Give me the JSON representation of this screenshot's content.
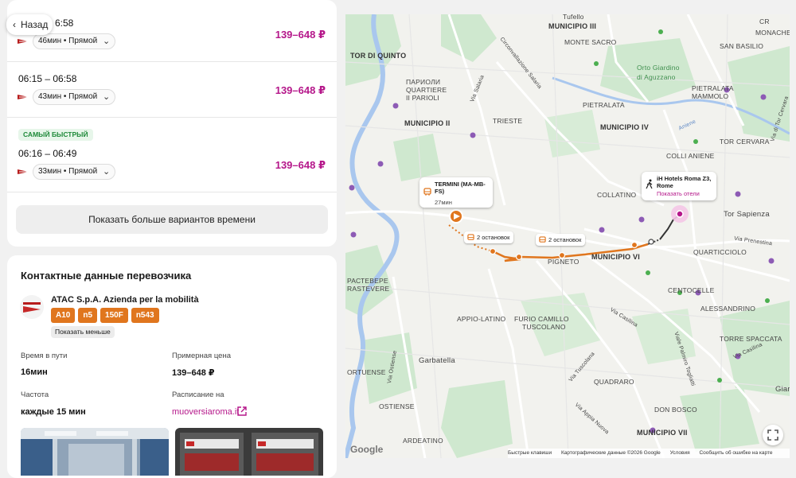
{
  "header": {
    "back_label": "Назад"
  },
  "trips": [
    {
      "time": "6:58",
      "duration": "46мин • Прямой",
      "price": "139–648 ₽"
    },
    {
      "time": "06:15 – 06:58",
      "duration": "43мин • Прямой",
      "price": "139–648 ₽"
    },
    {
      "badge": "САМЫЙ БЫСТРЫЙ",
      "time": "06:16 – 06:49",
      "duration": "33мин • Прямой",
      "price": "139–648 ₽"
    }
  ],
  "more_times_label": "Показать больше вариантов времени",
  "carrier": {
    "title": "Контактные данные перевозчика",
    "name": "ATAC S.p.A. Azienda per la mobilità",
    "routes": [
      "A10",
      "n5",
      "150F",
      "n543"
    ],
    "show_less_label": "Показать меньше",
    "travel_time_label": "Время в пути",
    "travel_time_value": "16мин",
    "price_label": "Примерная цена",
    "price_value": "139–648 ₽",
    "frequency_label": "Частота",
    "frequency_value": "каждые 15 мин",
    "schedule_label": "Расписание на",
    "schedule_link": "muoversiaroma.it"
  },
  "map": {
    "labels": {
      "tor_di_quinto": "TOR DI QUINTO",
      "tufello": "Tufello",
      "mun3": "MUNICIPIO III",
      "monte_sacro": "MONTE SACRO",
      "san_basilio": "SAN BASILIO",
      "cr": "CR",
      "monachese": "MONACHESE",
      "parioli": "ПАРИОЛИ",
      "quartiere": "QUARTIERE",
      "ii_parioli": "II PARIOLI",
      "orto_giardino": "Orto Giardino",
      "di_aguzzano": "di Aguzzano",
      "ponte_mammolo": "PONTE\nMAMMOLO",
      "pietralata": "PIETRALATA",
      "trieste": "TRIESTE",
      "mun2": "MUNICIPIO II",
      "mun4": "MUNICIPIO IV",
      "tor_cervara": "TOR CERVARA",
      "colli_aniene": "COLLI ANIENE",
      "collatino": "COLLATINO",
      "tor_sapienza": "Tor Sapienza",
      "quarticciolo": "QUARTICCIOLO",
      "mun6": "MUNICIPIO VI",
      "pigneto": "PIGNETO",
      "centocelle": "CENTOCELLE",
      "alessandrino": "ALESSANDRINO",
      "pastaverde": "РАСТЕВЕРЕ",
      "trastevere": "RASTEVERE",
      "appio_latino": "APPIO-LATINO",
      "furio": "FURIO CAMILLO",
      "tuscolano": "TUSCOLANO",
      "garbatella": "Garbatella",
      "ortuense": "ORTUENSE",
      "quadraro": "QUADRARO",
      "torre_spaccata": "TORRE SPACCATA",
      "ostiense": "OSTIENSE",
      "don_bosco": "DON BOSCO",
      "ardeatino": "ARDEATINO",
      "mun7": "MUNICIPIO VII",
      "giard": "Giar",
      "via_prenestina": "Via Prenestina",
      "via_casilina": "Via Casilina",
      "via_tuscolana": "Via Tuscolana",
      "via_appia": "Via Appia Nuova",
      "via_ostiense": "Via Ostiense",
      "via_salaria": "Via Salaria",
      "circonvallazione": "Circonvallazione Salaria",
      "aniene": "Aniene",
      "via_palmiro": "Viale Palmiro Togliatti",
      "via_tor_cervara": "Via di Tor Cervara"
    },
    "origin_title": "TERMINI (MA-MB-FS)",
    "origin_duration": "27мин",
    "destination_title": "iH Hotels Roma Z3, Rome",
    "destination_link": "Показать отели",
    "stops_1": "2 остановок",
    "stops_2": "2 остановок",
    "google": "Google",
    "attribution": {
      "shortcuts": "Быстрые клавиши",
      "data": "Картографические данные ©2026 Google",
      "terms": "Условия",
      "report": "Сообщить об ошибке на карте"
    }
  },
  "colors": {
    "price": "#b5178a",
    "route": "#e0761e",
    "badge_bg": "#e7f6ea",
    "badge_text": "#1f8a3a"
  }
}
